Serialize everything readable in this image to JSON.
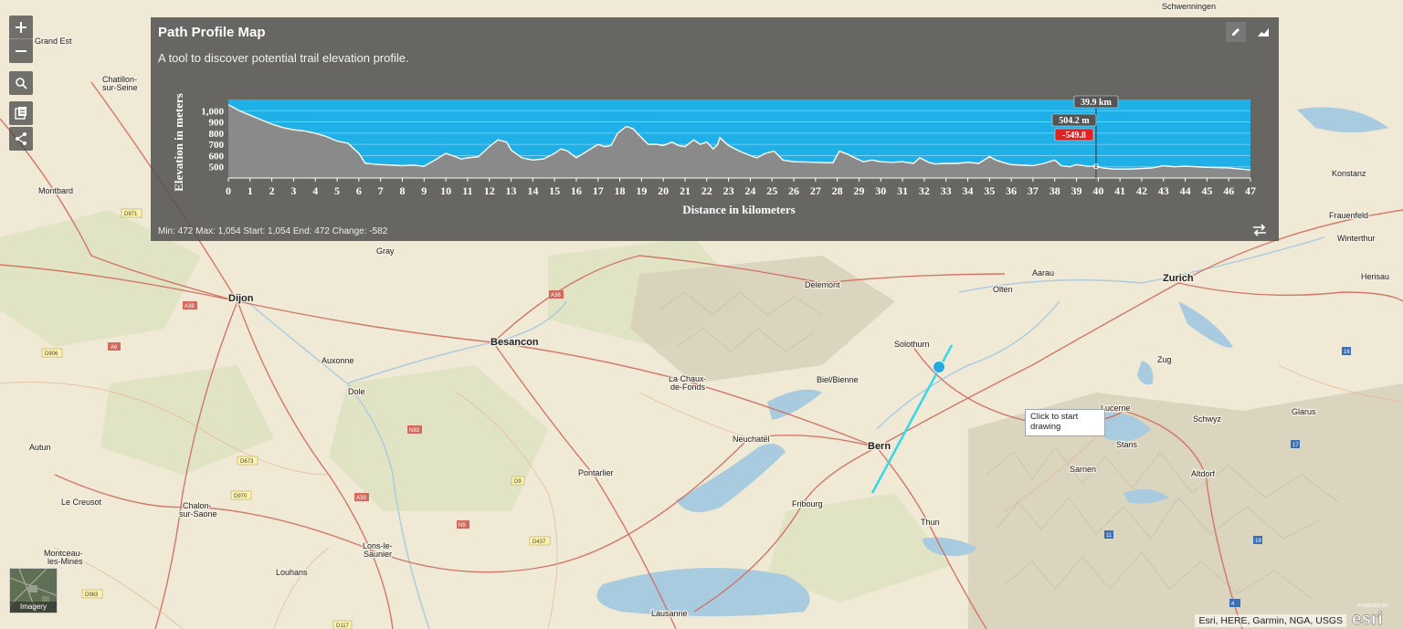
{
  "panel": {
    "title": "Path Profile Map",
    "description": "A tool to discover potential trail elevation profile.",
    "stats": "Min: 472 Max: 1,054 Start: 1,054 End: 472 Change: -582"
  },
  "map": {
    "tooltip": [
      "Click to start",
      "drawing"
    ],
    "basemap_label": "Imagery",
    "attribution": "Esri, HERE, Garmin, NGA, USGS",
    "logo_text": "esri",
    "logo_powered": "POWERED BY",
    "cities": [
      {
        "name": "Dijon",
        "major": true
      },
      {
        "name": "Besancon",
        "major": true
      },
      {
        "name": "Bern",
        "major": true
      },
      {
        "name": "Zurich",
        "major": true
      },
      {
        "name": "Chatillon-",
        "major": false
      },
      {
        "name": "sur-Seine",
        "major": false
      },
      {
        "name": "Montbard",
        "major": false
      },
      {
        "name": "Gray",
        "major": false
      },
      {
        "name": "Auxonne",
        "major": false
      },
      {
        "name": "Dole",
        "major": false
      },
      {
        "name": "Autun",
        "major": false
      },
      {
        "name": "Le Creusot",
        "major": false
      },
      {
        "name": "Chalon-",
        "major": false
      },
      {
        "name": "sur-Saone",
        "major": false
      },
      {
        "name": "Montceau-",
        "major": false
      },
      {
        "name": "les-Mines",
        "major": false
      },
      {
        "name": "Louhans",
        "major": false
      },
      {
        "name": "Lons-le-",
        "major": false
      },
      {
        "name": "Saunier",
        "major": false
      },
      {
        "name": "Pontarlier",
        "major": false
      },
      {
        "name": "La Chaux-",
        "major": false
      },
      {
        "name": "de-Fonds",
        "major": false
      },
      {
        "name": "Neuchatel",
        "major": false
      },
      {
        "name": "Biel/Bienne",
        "major": false
      },
      {
        "name": "Delemont",
        "major": false
      },
      {
        "name": "Solothurn",
        "major": false
      },
      {
        "name": "Olten",
        "major": false
      },
      {
        "name": "Aarau",
        "major": false
      },
      {
        "name": "Fribourg",
        "major": false
      },
      {
        "name": "Thun",
        "major": false
      },
      {
        "name": "Lausanne",
        "major": false
      },
      {
        "name": "Lucerne",
        "major": false
      },
      {
        "name": "Zug",
        "major": false
      },
      {
        "name": "Schwyz",
        "major": false
      },
      {
        "name": "Glarus",
        "major": false
      },
      {
        "name": "Stans",
        "major": false
      },
      {
        "name": "Sarnen",
        "major": false
      },
      {
        "name": "Altdorf",
        "major": false
      },
      {
        "name": "Konstanz",
        "major": false
      },
      {
        "name": "Frauenfeld",
        "major": false
      },
      {
        "name": "Winterthur",
        "major": false
      },
      {
        "name": "Herisau",
        "major": false
      },
      {
        "name": "Schwenningen",
        "major": false
      },
      {
        "name": "Grand Est",
        "major": false
      }
    ],
    "shields": [
      "D971",
      "D906",
      "A6",
      "A36",
      "A39",
      "D673",
      "D970",
      "D9",
      "D437",
      "D983",
      "D117",
      "A38",
      "N5",
      "A31",
      "A36",
      "N83",
      "16",
      "17",
      "19",
      "11",
      "4",
      "6"
    ]
  },
  "chart_data": {
    "type": "area",
    "ylabel": "Elevation in meters",
    "xlabel": "Distance in kilometers",
    "ylim": [
      400,
      1100
    ],
    "xlim": [
      0,
      47
    ],
    "yticks": [
      500,
      600,
      700,
      800,
      900,
      1000
    ],
    "ytick_labels": [
      "500",
      "600",
      "700",
      "800",
      "900",
      "1,000"
    ],
    "xticks": [
      "0",
      "1",
      "2",
      "3",
      "4",
      "5",
      "6",
      "7",
      "8",
      "9",
      "10",
      "11",
      "12",
      "13",
      "14",
      "15",
      "16",
      "17",
      "18",
      "19",
      "20",
      "21",
      "22",
      "23",
      "24",
      "25",
      "26",
      "27",
      "28",
      "29",
      "30",
      "31",
      "32",
      "33",
      "34",
      "35",
      "36",
      "37",
      "38",
      "39",
      "40",
      "41",
      "42",
      "43",
      "44",
      "45",
      "46",
      "47"
    ],
    "grid": true,
    "profile": [
      [
        0,
        1054
      ],
      [
        0.5,
        1000
      ],
      [
        1,
        960
      ],
      [
        1.5,
        920
      ],
      [
        2,
        880
      ],
      [
        2.5,
        850
      ],
      [
        3,
        830
      ],
      [
        3.5,
        820
      ],
      [
        4,
        800
      ],
      [
        4.5,
        770
      ],
      [
        5,
        730
      ],
      [
        5.5,
        710
      ],
      [
        6,
        620
      ],
      [
        6.3,
        530
      ],
      [
        7,
        520
      ],
      [
        8,
        510
      ],
      [
        8.5,
        515
      ],
      [
        9,
        505
      ],
      [
        9.5,
        560
      ],
      [
        10,
        620
      ],
      [
        10.3,
        600
      ],
      [
        10.7,
        570
      ],
      [
        11,
        580
      ],
      [
        11.5,
        590
      ],
      [
        12,
        680
      ],
      [
        12.4,
        740
      ],
      [
        12.8,
        720
      ],
      [
        13,
        650
      ],
      [
        13.5,
        580
      ],
      [
        14,
        560
      ],
      [
        14.5,
        570
      ],
      [
        15,
        620
      ],
      [
        15.3,
        660
      ],
      [
        15.6,
        640
      ],
      [
        16,
        580
      ],
      [
        16.5,
        640
      ],
      [
        17,
        700
      ],
      [
        17.3,
        680
      ],
      [
        17.6,
        690
      ],
      [
        17.9,
        800
      ],
      [
        18.3,
        860
      ],
      [
        18.6,
        840
      ],
      [
        19,
        760
      ],
      [
        19.3,
        700
      ],
      [
        19.7,
        700
      ],
      [
        20,
        690
      ],
      [
        20.4,
        720
      ],
      [
        20.7,
        690
      ],
      [
        21,
        680
      ],
      [
        21.4,
        740
      ],
      [
        21.7,
        700
      ],
      [
        22,
        720
      ],
      [
        22.3,
        660
      ],
      [
        22.5,
        700
      ],
      [
        22.6,
        760
      ],
      [
        23,
        690
      ],
      [
        23.5,
        640
      ],
      [
        24,
        600
      ],
      [
        24.3,
        580
      ],
      [
        24.7,
        620
      ],
      [
        25.1,
        640
      ],
      [
        25.5,
        560
      ],
      [
        26,
        545
      ],
      [
        27,
        540
      ],
      [
        27.8,
        535
      ],
      [
        28.1,
        640
      ],
      [
        28.5,
        610
      ],
      [
        28.8,
        580
      ],
      [
        29.2,
        545
      ],
      [
        29.6,
        560
      ],
      [
        30,
        545
      ],
      [
        30.5,
        540
      ],
      [
        31,
        545
      ],
      [
        31.5,
        530
      ],
      [
        31.8,
        580
      ],
      [
        32.2,
        540
      ],
      [
        32.5,
        525
      ],
      [
        33,
        530
      ],
      [
        33.5,
        530
      ],
      [
        34,
        540
      ],
      [
        34.5,
        530
      ],
      [
        35,
        590
      ],
      [
        35.3,
        560
      ],
      [
        35.6,
        540
      ],
      [
        36,
        520
      ],
      [
        37,
        510
      ],
      [
        37.5,
        530
      ],
      [
        38,
        560
      ],
      [
        38.3,
        510
      ],
      [
        38.7,
        500
      ],
      [
        39,
        520
      ],
      [
        39.5,
        505
      ],
      [
        39.9,
        504
      ],
      [
        40.2,
        490
      ],
      [
        40.7,
        480
      ],
      [
        41.5,
        480
      ],
      [
        42.5,
        490
      ],
      [
        43,
        510
      ],
      [
        43.5,
        500
      ],
      [
        44,
        505
      ],
      [
        45,
        495
      ],
      [
        46,
        490
      ],
      [
        47,
        472
      ]
    ],
    "cursor": {
      "distance_label": "39.9 km",
      "elevation_label": "504.2 m",
      "change_label": "-549.8",
      "x": 39.9,
      "y": 504.2
    }
  }
}
